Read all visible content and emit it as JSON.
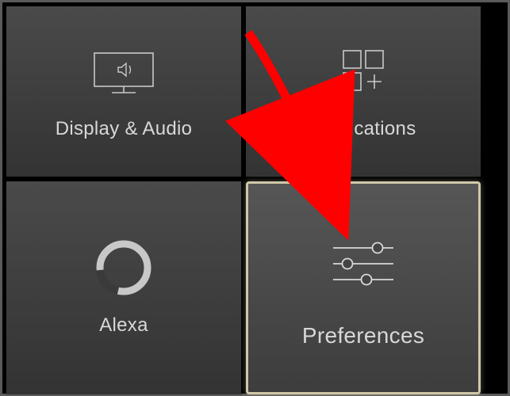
{
  "tiles": {
    "display_audio": {
      "label": "Display & Audio",
      "icon": "tv-sound-icon"
    },
    "applications": {
      "label": "Applications",
      "icon": "apps-grid-icon"
    },
    "alexa": {
      "label": "Alexa",
      "icon": "alexa-ring-icon"
    },
    "preferences": {
      "label": "Preferences",
      "icon": "sliders-icon"
    }
  },
  "annotation": {
    "color": "#ff0000",
    "target": "preferences"
  }
}
